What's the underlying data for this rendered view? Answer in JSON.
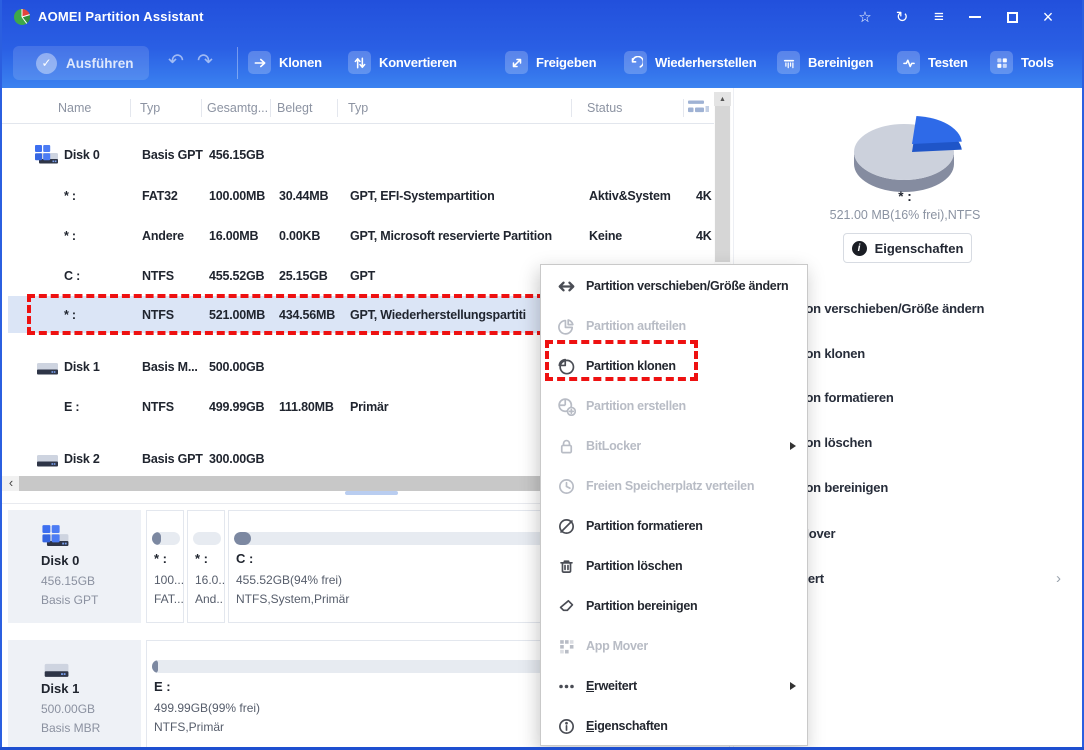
{
  "window": {
    "title": "AOMEI Partition Assistant"
  },
  "titlebar": {
    "icons": [
      "star",
      "refresh",
      "hamburger-menu",
      "minimize",
      "maximize",
      "close"
    ]
  },
  "toolbar": {
    "execute_label": "Ausführen",
    "buttons": [
      {
        "label": "Klonen",
        "icon": "clone-arrow"
      },
      {
        "label": "Konvertieren",
        "icon": "convert-arrows"
      },
      {
        "label": "Freigeben",
        "icon": "share-diagonal"
      },
      {
        "label": "Wiederherstellen",
        "icon": "restore-arrow"
      },
      {
        "label": "Bereinigen",
        "icon": "shredder"
      },
      {
        "label": "Testen",
        "icon": "pulse"
      },
      {
        "label": "Tools",
        "icon": "grid"
      }
    ]
  },
  "table": {
    "columns": [
      "Name",
      "Typ",
      "Gesamtg...",
      "Belegt",
      "Typ",
      "Status"
    ],
    "rows": [
      {
        "name": "Disk 0",
        "fs": "Basis GPT",
        "total": "456.15GB",
        "used": "",
        "type": "",
        "status": "",
        "sector": ""
      },
      {
        "name": "* :",
        "fs": "FAT32",
        "total": "100.00MB",
        "used": "30.44MB",
        "type": "GPT, EFI-Systempartition",
        "status": "Aktiv&System",
        "sector": "4K"
      },
      {
        "name": "* :",
        "fs": "Andere",
        "total": "16.00MB",
        "used": "0.00KB",
        "type": "GPT, Microsoft reservierte Partition",
        "status": "Keine",
        "sector": "4K"
      },
      {
        "name": "C :",
        "fs": "NTFS",
        "total": "455.52GB",
        "used": "25.15GB",
        "type": "GPT",
        "status": "",
        "sector": ""
      },
      {
        "name": "* :",
        "fs": "NTFS",
        "total": "521.00MB",
        "used": "434.56MB",
        "type": "GPT, Wiederherstellungspartiti",
        "status": "",
        "sector": ""
      },
      {
        "name": "Disk 1",
        "fs": "Basis M...",
        "total": "500.00GB",
        "used": "",
        "type": "",
        "status": "",
        "sector": ""
      },
      {
        "name": "E :",
        "fs": "NTFS",
        "total": "499.99GB",
        "used": "111.80MB",
        "type": "Primär",
        "status": "",
        "sector": ""
      },
      {
        "name": "Disk 2",
        "fs": "Basis GPT",
        "total": "300.00GB",
        "used": "",
        "type": "",
        "status": "",
        "sector": ""
      }
    ]
  },
  "context_menu": {
    "items": [
      {
        "label": "Partition verschieben/Größe ändern",
        "enabled": true,
        "icon": "move-resize"
      },
      {
        "label": "Partition aufteilen",
        "enabled": false,
        "icon": "pie-split"
      },
      {
        "label": "Partition klonen",
        "enabled": true,
        "icon": "pie-clone",
        "highlighted": true
      },
      {
        "label": "Partition erstellen",
        "enabled": false,
        "icon": "pie-plus"
      },
      {
        "label": "BitLocker",
        "enabled": false,
        "icon": "lock",
        "submenu": true
      },
      {
        "label": "Freien Speicherplatz verteilen",
        "enabled": false,
        "icon": "clock"
      },
      {
        "label": "Partition formatieren",
        "enabled": true,
        "icon": "pie-slash"
      },
      {
        "label": "Partition löschen",
        "enabled": true,
        "icon": "trash"
      },
      {
        "label": "Partition bereinigen",
        "enabled": true,
        "icon": "eraser"
      },
      {
        "label": "App Mover",
        "enabled": false,
        "icon": "app-grid"
      },
      {
        "label": "Erweitert",
        "enabled": true,
        "icon": "dots",
        "submenu": true,
        "underline_first": true
      },
      {
        "label": "Eigenschaften",
        "enabled": true,
        "icon": "info",
        "underline_first": true
      }
    ]
  },
  "right_panel": {
    "volume_label": "* :",
    "volume_info": "521.00 MB(16% frei),NTFS",
    "properties_label": "Eigenschaften",
    "pie": {
      "free_pct": 16,
      "used_pct": 84,
      "slice_color": "#2e6ae8",
      "body_color": "#ccd1dc"
    },
    "menu": [
      {
        "label": "Partition verschieben/Größe ändern"
      },
      {
        "label": "Partition klonen"
      },
      {
        "label": "Partition formatieren"
      },
      {
        "label": "Partition löschen"
      },
      {
        "label": "Partition bereinigen"
      },
      {
        "label": "App Mover"
      },
      {
        "label": "Erweitert",
        "submenu": true
      }
    ]
  },
  "bottom_panel": {
    "disks": [
      {
        "name": "Disk 0",
        "size": "456.15GB",
        "style": "Basis GPT",
        "partitions": [
          {
            "name": "* :",
            "line2": "100....",
            "line3": "FAT..."
          },
          {
            "name": "* :",
            "line2": "16.0...",
            "line3": "And..."
          },
          {
            "name": "C :",
            "line2": "455.52GB(94% frei)",
            "line3": "NTFS,System,Primär"
          }
        ]
      },
      {
        "name": "Disk 1",
        "size": "500.00GB",
        "style": "Basis MBR",
        "partitions": [
          {
            "name": "E :",
            "line2": "499.99GB(99% frei)",
            "line3": "NTFS,Primär"
          }
        ]
      }
    ]
  },
  "colors": {
    "titlebar_blue": "#2a5fe4",
    "selection": "#dbe5f6",
    "annotation_red": "#ee1111",
    "accent_blue": "#2e6ae8"
  }
}
